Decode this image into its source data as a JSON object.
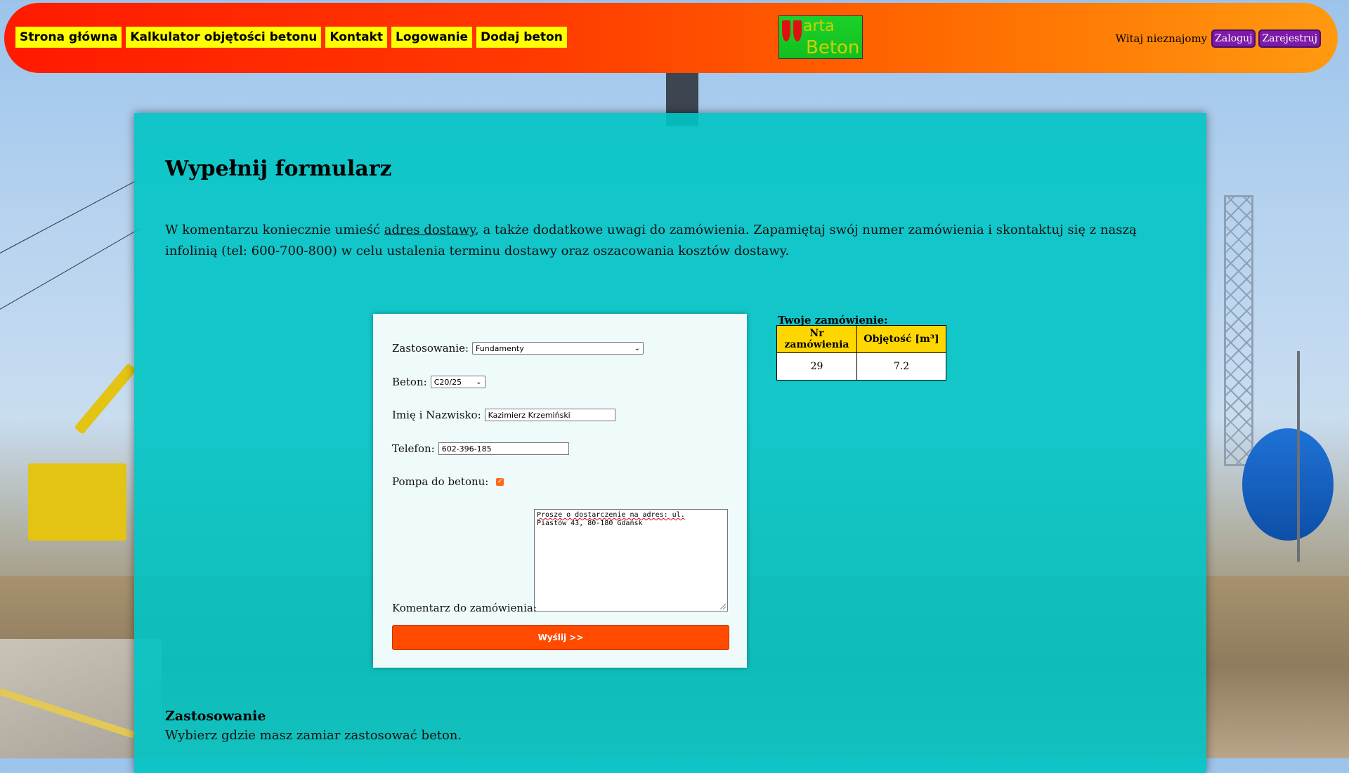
{
  "nav": {
    "items": [
      {
        "label": "Strona główna"
      },
      {
        "label": "Kalkulator objętości betonu"
      },
      {
        "label": "Kontakt"
      },
      {
        "label": "Logowanie"
      },
      {
        "label": "Dodaj beton"
      }
    ]
  },
  "logo": {
    "line1": "arta",
    "line2": "Beton"
  },
  "user": {
    "welcome": "Witaj nieznajomy",
    "login": "Zaloguj",
    "register": "Zarejestruj"
  },
  "page": {
    "title": "Wypełnij formularz",
    "intro_before": "W komentarzu koniecznie umieść ",
    "intro_link": "adres dostawy",
    "intro_after": ", a także dodatkowe uwagi do zamówienia. Zapamiętaj swój numer zamówienia i skontaktuj się z naszą infolinią (tel: 600-700-800) w celu ustalenia terminu dostawy oraz oszacowania kosztów dostawy."
  },
  "form": {
    "usage_label": "Zastosowanie:",
    "usage_value": "Fundamenty",
    "concrete_label": "Beton:",
    "concrete_value": "C20/25",
    "name_label": "Imię i Nazwisko:",
    "name_value": "Kazimierz Krzemiński",
    "phone_label": "Telefon:",
    "phone_value": "602-396-185",
    "pump_label": "Pompa do betonu:",
    "pump_checked": true,
    "comment_label": "Komentarz do zamówienia:",
    "comment_value_line1": "Prosze o dostarczenie na adres: ul.",
    "comment_value_line2": "Piastów 43, 80-180 Gdańsk",
    "submit_label": "Wyślij >>"
  },
  "order": {
    "title": "Twoje zamówienie:",
    "headers": [
      "Nr zamówienia",
      "Objętość [m³]"
    ],
    "row": [
      "29",
      "7.2"
    ]
  },
  "section": {
    "heading": "Zastosowanie",
    "text": "Wybierz gdzie masz zamiar zastosować beton."
  }
}
